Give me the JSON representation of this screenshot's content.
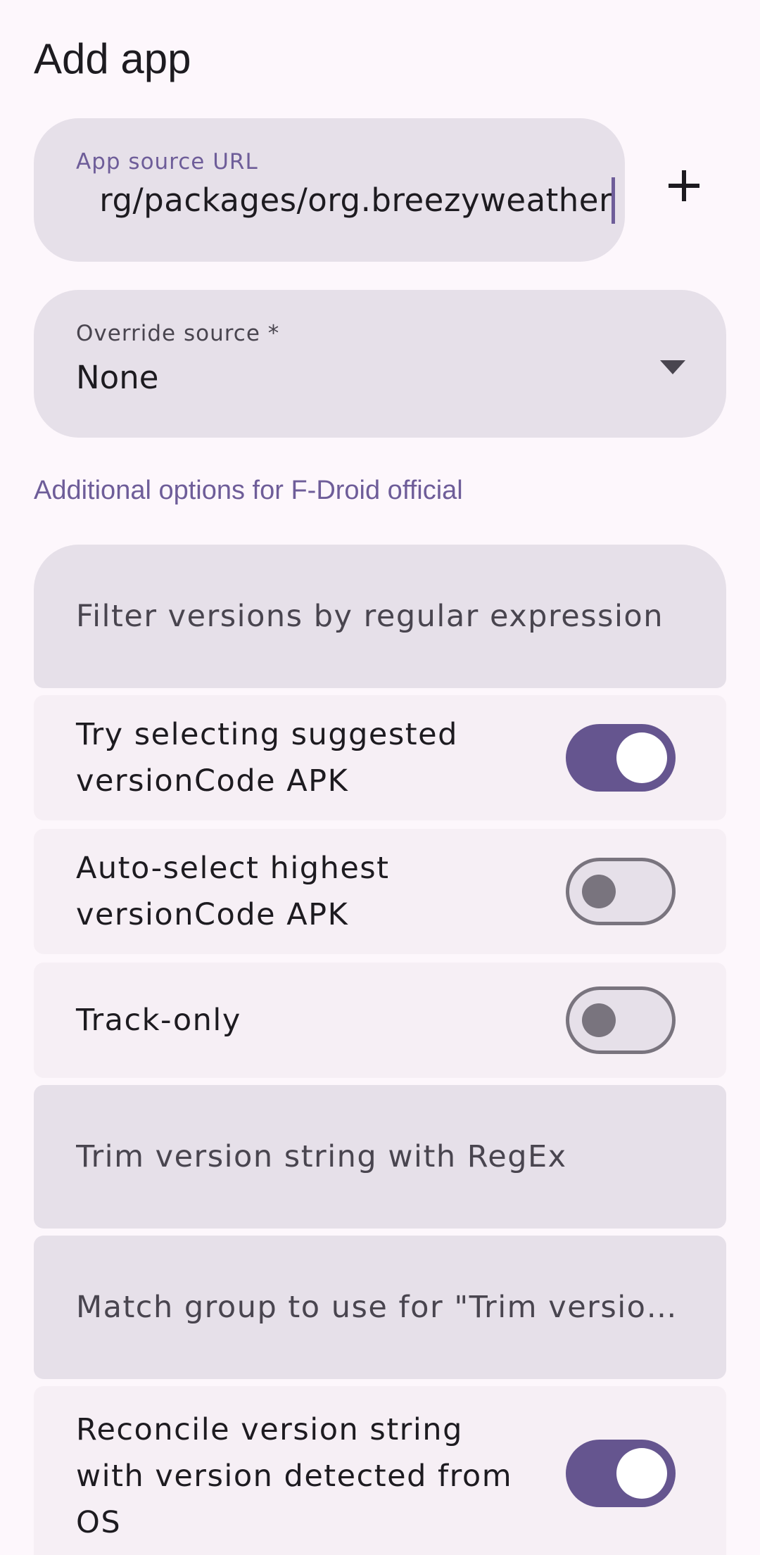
{
  "page": {
    "title": "Add app"
  },
  "url_field": {
    "label": "App source URL",
    "value": "rg/packages/org.breezyweather",
    "add_icon": "plus-icon"
  },
  "override_source": {
    "label": "Override source *",
    "selected": "None",
    "arrow_icon": "dropdown-arrow-icon"
  },
  "section": {
    "heading": "Additional options for F-Droid official"
  },
  "fields": {
    "filter_versions_placeholder": "Filter versions by regular expression",
    "trim_version_placeholder": "Trim version string with RegEx",
    "match_group_placeholder": "Match group to use for \"Trim versio…"
  },
  "switches": [
    {
      "label": "Try selecting suggested versionCode APK",
      "on": true
    },
    {
      "label": "Auto-select highest versionCode APK",
      "on": false
    },
    {
      "label": "Track-only",
      "on": false
    },
    {
      "label": "Reconcile version string with version detected from OS",
      "on": true
    }
  ],
  "colors": {
    "accent": "#65558f",
    "field_background": "#e6e0e9",
    "row_background": "#f6eff5",
    "page_background": "#fdf7fc"
  }
}
